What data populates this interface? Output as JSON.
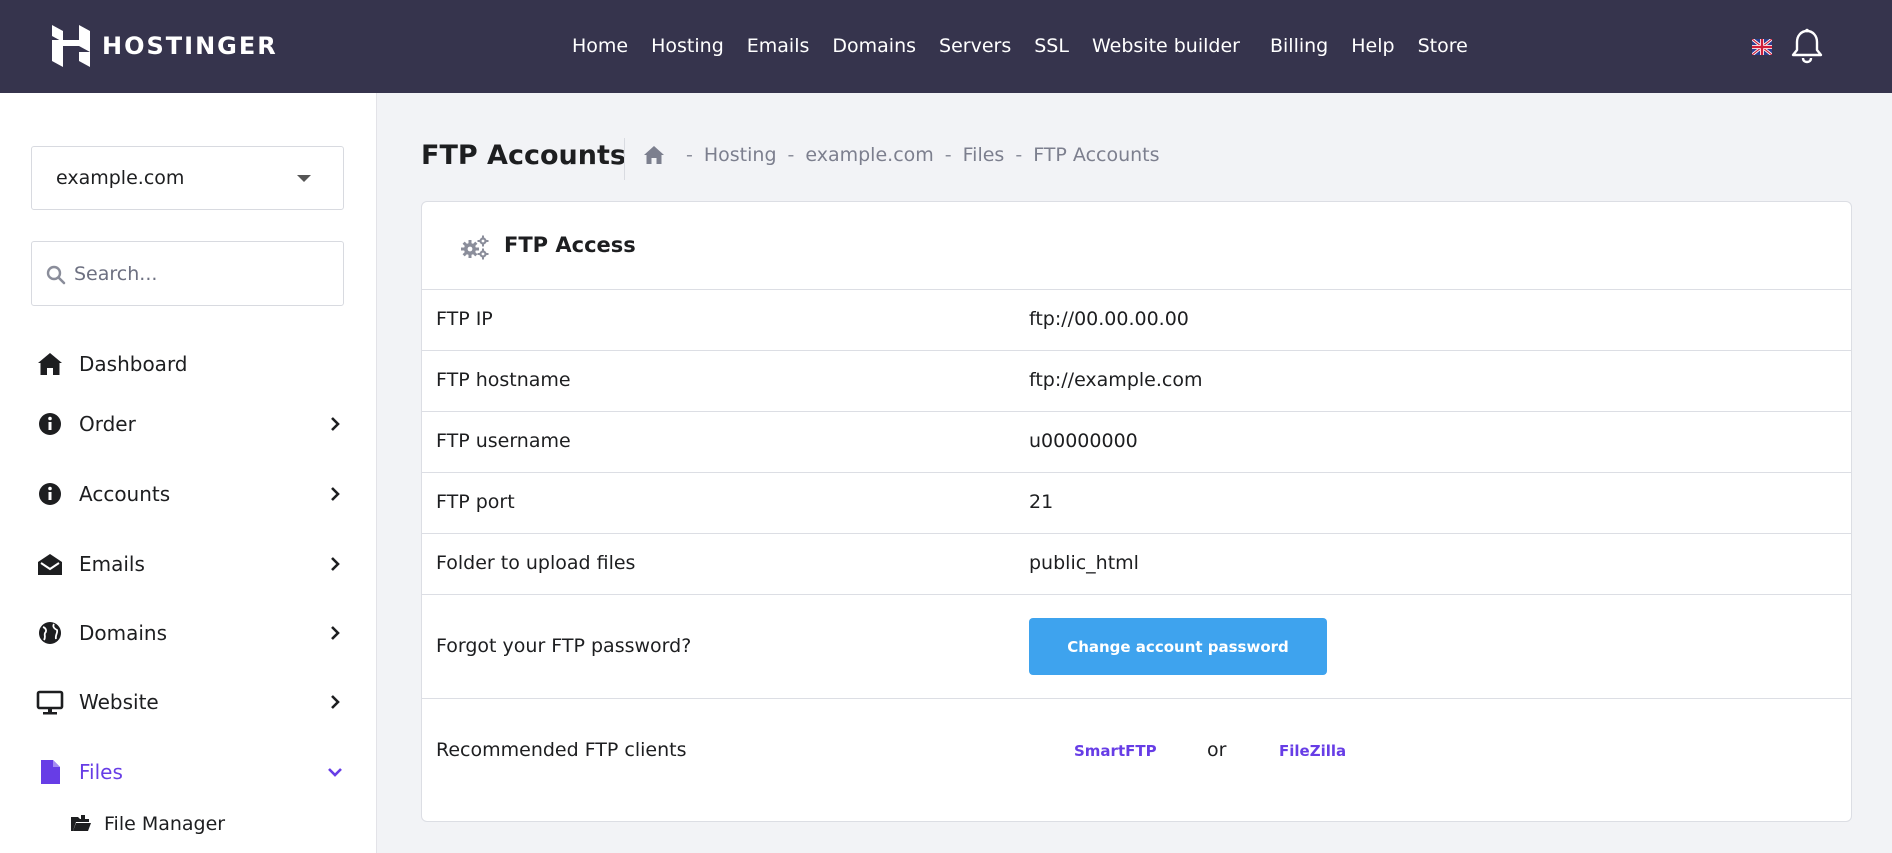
{
  "header": {
    "brand": "HOSTINGER",
    "nav": [
      "Home",
      "Hosting",
      "Emails",
      "Domains",
      "Servers",
      "SSL",
      "Website builder",
      "Billing",
      "Help",
      "Store"
    ]
  },
  "sidebar": {
    "domain_selected": "example.com",
    "search_placeholder": "Search...",
    "items": [
      {
        "label": "Dashboard",
        "icon": "home-icon"
      },
      {
        "label": "Order",
        "icon": "info-icon"
      },
      {
        "label": "Accounts",
        "icon": "info-icon"
      },
      {
        "label": "Emails",
        "icon": "envelope-icon"
      },
      {
        "label": "Domains",
        "icon": "globe-icon"
      },
      {
        "label": "Website",
        "icon": "monitor-icon"
      },
      {
        "label": "Files",
        "icon": "file-icon"
      }
    ],
    "sub_items": [
      {
        "label": "File Manager",
        "icon": "folder-icon"
      }
    ]
  },
  "page": {
    "title": "FTP Accounts",
    "breadcrumb": [
      "Hosting",
      "example.com",
      "Files",
      "FTP Accounts"
    ],
    "separator": "-"
  },
  "card": {
    "title": "FTP Access",
    "rows": [
      {
        "label": "FTP IP",
        "value": "ftp://00.00.00.00"
      },
      {
        "label": "FTP hostname",
        "value": "ftp://example.com"
      },
      {
        "label": "FTP username",
        "value": "u00000000"
      },
      {
        "label": "FTP port",
        "value": "21"
      },
      {
        "label": "Folder to upload files",
        "value": "public_html"
      }
    ],
    "password_label": "Forgot your FTP password?",
    "password_button": "Change account password",
    "clients_label": "Recommended FTP clients",
    "client_1": "SmartFTP",
    "or": "or",
    "client_2": "FileZilla"
  },
  "colors": {
    "header_bg": "#36344d",
    "accent": "#673de6",
    "button": "#3ea3ee"
  }
}
